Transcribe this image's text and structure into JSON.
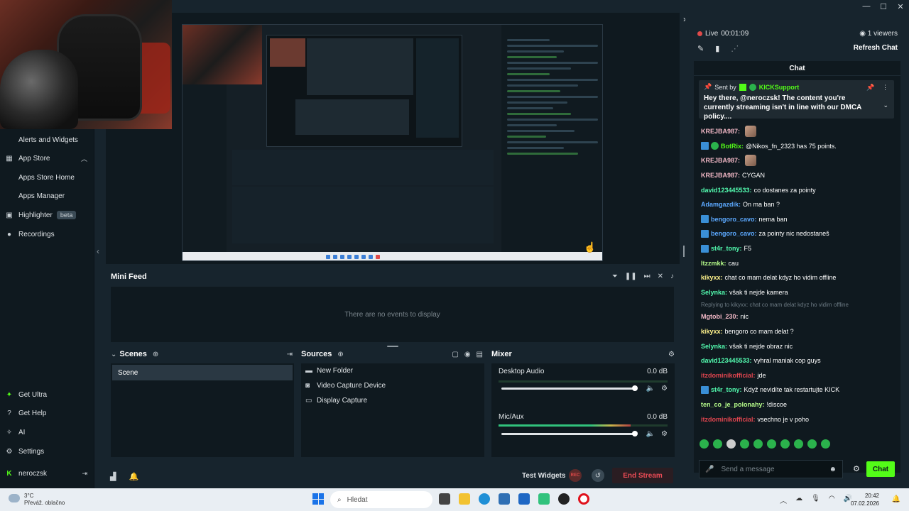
{
  "sidebar": {
    "items": [
      {
        "label": "Alerts and Widgets",
        "sub": true
      },
      {
        "label": "App Store",
        "icon": "app-store-icon"
      },
      {
        "label": "Apps Store Home",
        "sub": true
      },
      {
        "label": "Apps Manager",
        "sub": true
      },
      {
        "label": "Highlighter",
        "badge": "beta",
        "icon": "highlighter-icon"
      },
      {
        "label": "Recordings",
        "icon": "recordings-icon"
      }
    ],
    "bottom": [
      {
        "label": "Get Ultra",
        "icon": "ultra-icon"
      },
      {
        "label": "Get Help",
        "icon": "help-icon"
      },
      {
        "label": "AI",
        "icon": "ai-icon"
      },
      {
        "label": "Settings",
        "icon": "gear-icon"
      },
      {
        "label": "neroczsk",
        "icon": "kick-icon"
      }
    ]
  },
  "minifeed": {
    "title": "Mini Feed",
    "empty": "There are no events to display"
  },
  "scenes": {
    "title": "Scenes",
    "items": [
      "Scene"
    ]
  },
  "sources": {
    "title": "Sources",
    "items": [
      "New Folder",
      "Video Capture Device",
      "Display Capture"
    ]
  },
  "mixer": {
    "title": "Mixer",
    "channels": [
      {
        "name": "Desktop Audio",
        "db": "0.0 dB",
        "level": 0.0
      },
      {
        "name": "Mic/Aux",
        "db": "0.0 dB",
        "level": 0.78
      }
    ]
  },
  "bottombar": {
    "test_widgets": "Test Widgets",
    "rec": "REC",
    "end_stream": "End Stream"
  },
  "stream": {
    "live_label": "Live",
    "time": "00:01:09",
    "viewers": "1 viewers",
    "refresh_chat": "Refresh Chat"
  },
  "chat": {
    "title": "Chat",
    "pinned": {
      "sent_by": "Sent by",
      "user": "KICKSupport",
      "text": "Hey there, @neroczsk! The content you're currently streaming isn't in line with our DMCA policy...."
    },
    "messages": [
      {
        "user": "KREJBA987:",
        "text": "",
        "color": "#f2b8c6",
        "emote": true
      },
      {
        "user": "BotRix:",
        "text": "@Nikos_fn_2323 has 75 points.",
        "color": "#53fc18",
        "badges": [
          "mod",
          "verified"
        ]
      },
      {
        "user": "KREJBA987:",
        "text": "",
        "color": "#f2b8c6",
        "emote": true
      },
      {
        "user": "KREJBA987:",
        "text": "CYGAN",
        "color": "#f2b8c6"
      },
      {
        "user": "david123445533:",
        "text": "co dostanes za pointy",
        "color": "#53fcb0"
      },
      {
        "user": "Adamgazdik:",
        "text": "On ma ban ?",
        "color": "#5ca9ff"
      },
      {
        "user": "bengoro_cavo:",
        "text": "nema ban",
        "color": "#5ca9ff",
        "badges": [
          "mod"
        ]
      },
      {
        "user": "bengoro_cavo:",
        "text": "za pointy nic nedostaneš",
        "color": "#5ca9ff",
        "badges": [
          "mod"
        ]
      },
      {
        "user": "st4r_tony:",
        "text": "F5",
        "color": "#53fcb0",
        "badges": [
          "mod"
        ]
      },
      {
        "user": "Itzzmkk:",
        "text": "cau",
        "color": "#b6fc8a"
      },
      {
        "user": "kikyxx:",
        "text": "chat co mam delat kdyz ho vidim offline",
        "color": "#fcf08a"
      },
      {
        "user": "Selynka:",
        "text": "však ti nejde kamera",
        "color": "#53fcb0"
      },
      {
        "reply": "Replying to kikyxx: chat co mam delat kdyz ho vidim offline"
      },
      {
        "user": "Mgtobi_230:",
        "text": "nic",
        "color": "#f2b8c6"
      },
      {
        "user": "kikyxx:",
        "text": "bengoro co mam delat ?",
        "color": "#fcf08a"
      },
      {
        "user": "Selynka:",
        "text": "však ti nejde obraz nic",
        "color": "#53fcb0"
      },
      {
        "user": "david123445533:",
        "text": "vyhral maniak cop guys",
        "color": "#53fcb0"
      },
      {
        "user": "itzdominikofficial:",
        "text": "jde",
        "color": "#e0454f"
      },
      {
        "user": "st4r_tony:",
        "text": "Když nevidíte tak restartujte KICK",
        "color": "#53fcb0",
        "badges": [
          "mod"
        ]
      },
      {
        "user": "ten_co_je_polonahy:",
        "text": "!discoe",
        "color": "#b6fc8a"
      },
      {
        "user": "itzdominikofficial:",
        "text": "vsechno je v poho",
        "color": "#e0454f"
      }
    ],
    "input_placeholder": "Send a message",
    "send_label": "Chat"
  },
  "taskbar": {
    "weather_temp": "3°C",
    "weather_desc": "Převáž. oblačno",
    "search_placeholder": "Hledat",
    "time": "20:42",
    "date": "07.02.2026"
  },
  "colors": {
    "accent": "#53fc18",
    "end_stream": "#ea4b55",
    "panel_bg": "#0f191f",
    "app_bg": "#17242d"
  }
}
